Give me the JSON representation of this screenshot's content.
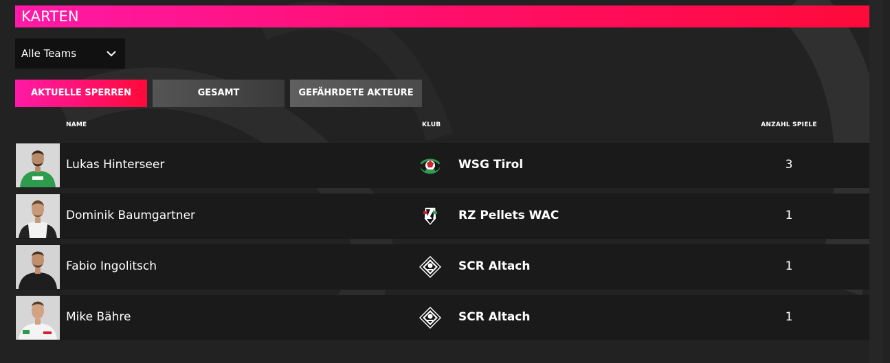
{
  "header": {
    "title": "KARTEN"
  },
  "team_filter": {
    "selected": "Alle Teams"
  },
  "tabs": [
    {
      "label": "AKTUELLE SPERREN",
      "active": true
    },
    {
      "label": "GESAMT",
      "active": false
    },
    {
      "label": "GEFÄHRDETE AKTEURE",
      "active": false
    }
  ],
  "table": {
    "columns": {
      "name": "NAME",
      "club": "KLUB",
      "games": "ANZAHL SPIELE"
    },
    "rows": [
      {
        "player": "Lukas Hinterseer",
        "club": "WSG Tirol",
        "games": "3",
        "crest": "wsg-tirol-crest-icon"
      },
      {
        "player": "Dominik Baumgartner",
        "club": "RZ Pellets WAC",
        "games": "1",
        "crest": "wac-crest-icon"
      },
      {
        "player": "Fabio Ingolitsch",
        "club": "SCR Altach",
        "games": "1",
        "crest": "scr-altach-crest-icon"
      },
      {
        "player": "Mike Bähre",
        "club": "SCR Altach",
        "games": "1",
        "crest": "scr-altach-crest-icon"
      }
    ]
  },
  "colors": {
    "background": "#222222",
    "accent_pink": "#ff1aa8",
    "accent_red": "#ff0a3a",
    "row_background": "#1a1a1a"
  }
}
